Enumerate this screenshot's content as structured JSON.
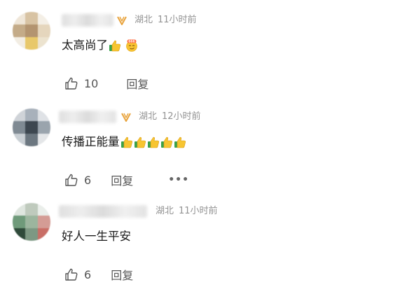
{
  "comments": [
    {
      "username": "",
      "region": "湖北",
      "time": "11小时前",
      "text": "太高尚了",
      "emojis": [
        "thumbs-up",
        "smirk-666"
      ],
      "likes": "10",
      "reply_label": "回复",
      "has_vip": true,
      "has_more": false
    },
    {
      "username": "",
      "region": "湖北",
      "time": "12小时前",
      "text": "传播正能量",
      "emojis": [
        "thumbs-up",
        "thumbs-up",
        "thumbs-up",
        "thumbs-up",
        "thumbs-up"
      ],
      "likes": "6",
      "reply_label": "回复",
      "has_vip": true,
      "has_more": true,
      "more_label": "•••"
    },
    {
      "username": "",
      "region": "湖北",
      "time": "11小时前",
      "text": "好人一生平安",
      "emojis": [],
      "likes": "6",
      "reply_label": "回复",
      "has_vip": false,
      "has_more": false
    }
  ],
  "colors": {
    "meta_text": "#939393",
    "vip_gold": "#e8a33c",
    "thumb_yellow": "#f7c531",
    "thumb_green": "#3aa14a"
  }
}
